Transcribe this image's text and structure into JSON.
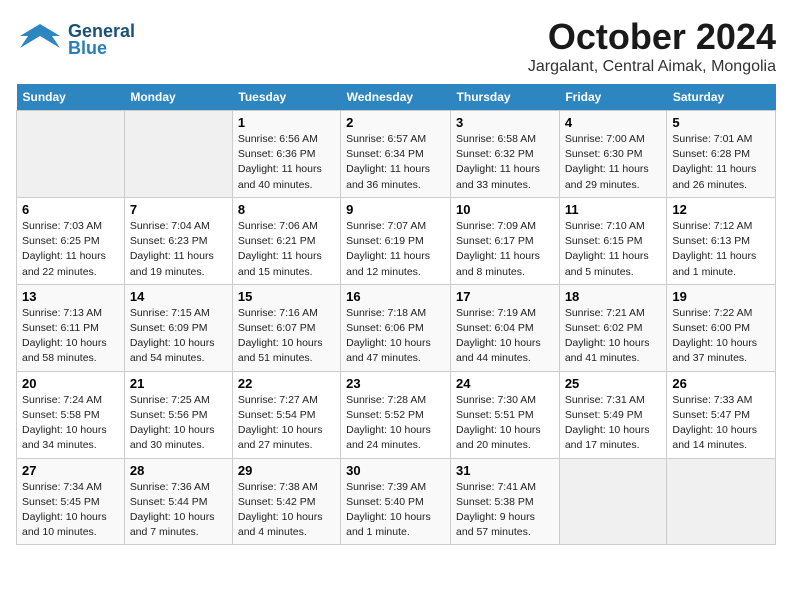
{
  "header": {
    "logo_general": "General",
    "logo_blue": "Blue",
    "title": "October 2024",
    "subtitle": "Jargalant, Central Aimak, Mongolia"
  },
  "days_of_week": [
    "Sunday",
    "Monday",
    "Tuesday",
    "Wednesday",
    "Thursday",
    "Friday",
    "Saturday"
  ],
  "weeks": [
    [
      {
        "day": "",
        "empty": true
      },
      {
        "day": "",
        "empty": true
      },
      {
        "day": "1",
        "sunrise": "6:56 AM",
        "sunset": "6:36 PM",
        "daylight": "11 hours and 40 minutes."
      },
      {
        "day": "2",
        "sunrise": "6:57 AM",
        "sunset": "6:34 PM",
        "daylight": "11 hours and 36 minutes."
      },
      {
        "day": "3",
        "sunrise": "6:58 AM",
        "sunset": "6:32 PM",
        "daylight": "11 hours and 33 minutes."
      },
      {
        "day": "4",
        "sunrise": "7:00 AM",
        "sunset": "6:30 PM",
        "daylight": "11 hours and 29 minutes."
      },
      {
        "day": "5",
        "sunrise": "7:01 AM",
        "sunset": "6:28 PM",
        "daylight": "11 hours and 26 minutes."
      }
    ],
    [
      {
        "day": "6",
        "sunrise": "7:03 AM",
        "sunset": "6:25 PM",
        "daylight": "11 hours and 22 minutes."
      },
      {
        "day": "7",
        "sunrise": "7:04 AM",
        "sunset": "6:23 PM",
        "daylight": "11 hours and 19 minutes."
      },
      {
        "day": "8",
        "sunrise": "7:06 AM",
        "sunset": "6:21 PM",
        "daylight": "11 hours and 15 minutes."
      },
      {
        "day": "9",
        "sunrise": "7:07 AM",
        "sunset": "6:19 PM",
        "daylight": "11 hours and 12 minutes."
      },
      {
        "day": "10",
        "sunrise": "7:09 AM",
        "sunset": "6:17 PM",
        "daylight": "11 hours and 8 minutes."
      },
      {
        "day": "11",
        "sunrise": "7:10 AM",
        "sunset": "6:15 PM",
        "daylight": "11 hours and 5 minutes."
      },
      {
        "day": "12",
        "sunrise": "7:12 AM",
        "sunset": "6:13 PM",
        "daylight": "11 hours and 1 minute."
      }
    ],
    [
      {
        "day": "13",
        "sunrise": "7:13 AM",
        "sunset": "6:11 PM",
        "daylight": "10 hours and 58 minutes."
      },
      {
        "day": "14",
        "sunrise": "7:15 AM",
        "sunset": "6:09 PM",
        "daylight": "10 hours and 54 minutes."
      },
      {
        "day": "15",
        "sunrise": "7:16 AM",
        "sunset": "6:07 PM",
        "daylight": "10 hours and 51 minutes."
      },
      {
        "day": "16",
        "sunrise": "7:18 AM",
        "sunset": "6:06 PM",
        "daylight": "10 hours and 47 minutes."
      },
      {
        "day": "17",
        "sunrise": "7:19 AM",
        "sunset": "6:04 PM",
        "daylight": "10 hours and 44 minutes."
      },
      {
        "day": "18",
        "sunrise": "7:21 AM",
        "sunset": "6:02 PM",
        "daylight": "10 hours and 41 minutes."
      },
      {
        "day": "19",
        "sunrise": "7:22 AM",
        "sunset": "6:00 PM",
        "daylight": "10 hours and 37 minutes."
      }
    ],
    [
      {
        "day": "20",
        "sunrise": "7:24 AM",
        "sunset": "5:58 PM",
        "daylight": "10 hours and 34 minutes."
      },
      {
        "day": "21",
        "sunrise": "7:25 AM",
        "sunset": "5:56 PM",
        "daylight": "10 hours and 30 minutes."
      },
      {
        "day": "22",
        "sunrise": "7:27 AM",
        "sunset": "5:54 PM",
        "daylight": "10 hours and 27 minutes."
      },
      {
        "day": "23",
        "sunrise": "7:28 AM",
        "sunset": "5:52 PM",
        "daylight": "10 hours and 24 minutes."
      },
      {
        "day": "24",
        "sunrise": "7:30 AM",
        "sunset": "5:51 PM",
        "daylight": "10 hours and 20 minutes."
      },
      {
        "day": "25",
        "sunrise": "7:31 AM",
        "sunset": "5:49 PM",
        "daylight": "10 hours and 17 minutes."
      },
      {
        "day": "26",
        "sunrise": "7:33 AM",
        "sunset": "5:47 PM",
        "daylight": "10 hours and 14 minutes."
      }
    ],
    [
      {
        "day": "27",
        "sunrise": "7:34 AM",
        "sunset": "5:45 PM",
        "daylight": "10 hours and 10 minutes."
      },
      {
        "day": "28",
        "sunrise": "7:36 AM",
        "sunset": "5:44 PM",
        "daylight": "10 hours and 7 minutes."
      },
      {
        "day": "29",
        "sunrise": "7:38 AM",
        "sunset": "5:42 PM",
        "daylight": "10 hours and 4 minutes."
      },
      {
        "day": "30",
        "sunrise": "7:39 AM",
        "sunset": "5:40 PM",
        "daylight": "10 hours and 1 minute."
      },
      {
        "day": "31",
        "sunrise": "7:41 AM",
        "sunset": "5:38 PM",
        "daylight": "9 hours and 57 minutes."
      },
      {
        "day": "",
        "empty": true
      },
      {
        "day": "",
        "empty": true
      }
    ]
  ]
}
